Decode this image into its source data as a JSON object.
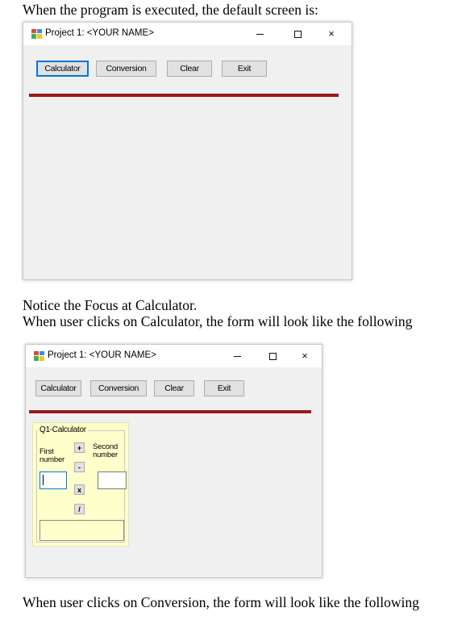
{
  "doc": {
    "para1": "When the program is executed, the default screen is:",
    "para2_line1": "Notice the Focus at Calculator.",
    "para2_line2": "When user clicks on Calculator, the form will look like the following",
    "para3": "When user clicks on Conversion, the form will look like the following"
  },
  "window": {
    "title": "Project 1: <YOUR NAME>",
    "buttons": {
      "calculator": "Calculator",
      "conversion": "Conversion",
      "clear": "Clear",
      "exit": "Exit"
    },
    "focused_button": "Calculator",
    "accent_color": "#0078d7",
    "separator_color": "#9b1b1b",
    "icons": [
      "app-icon",
      "minimize-icon",
      "maximize-icon",
      "close-icon"
    ],
    "close_glyph": "×"
  },
  "calculator": {
    "group_title": "Q1-Calculator",
    "first_label": "First number",
    "second_label": "Second number",
    "ops": {
      "add": "+",
      "subtract": "-",
      "multiply": "x",
      "divide": "/"
    },
    "group_bg": "#ffffcc"
  }
}
